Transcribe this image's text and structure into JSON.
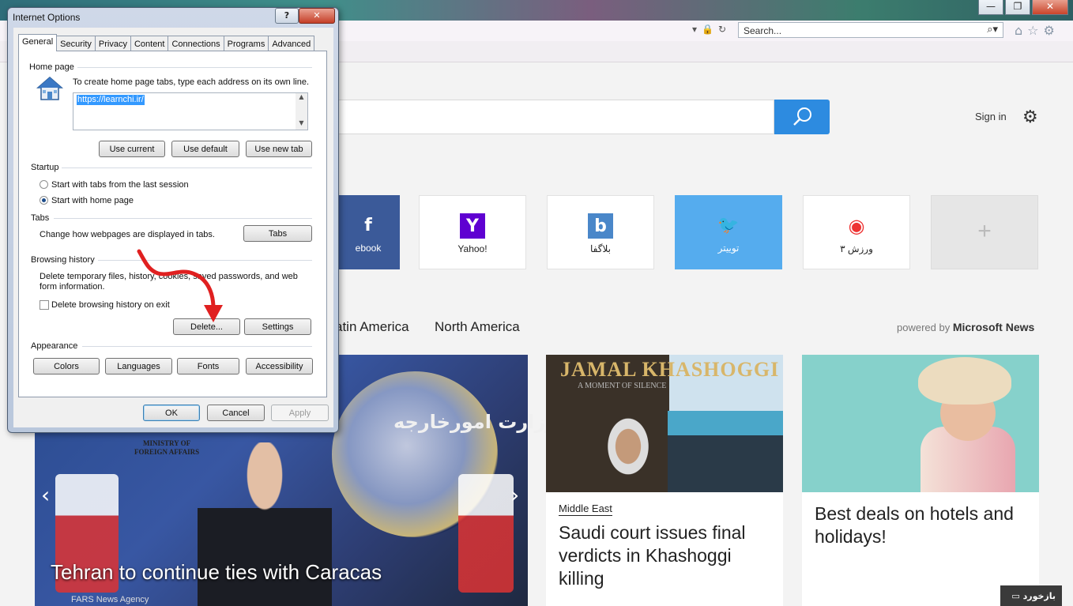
{
  "browser": {
    "window_buttons": {
      "minimize": "—",
      "maximize": "❐",
      "close": "✕"
    },
    "search_placeholder": "Search...",
    "nav_icons": {
      "home": "home-icon",
      "favorites": "star-icon",
      "tools": "gear-icon"
    }
  },
  "msn": {
    "sign_in": "Sign in",
    "tiles": [
      {
        "label": "ebook",
        "icon": "facebook-icon",
        "glyph": "f"
      },
      {
        "label": "Yahoo!",
        "icon": "yahoo-icon",
        "glyph": "Y"
      },
      {
        "label": "بلاگفا",
        "icon": "blogfa-icon",
        "glyph": "b"
      },
      {
        "label": "توییتر",
        "icon": "twitter-icon",
        "glyph": "🐦"
      },
      {
        "label": "ورزش ۳",
        "icon": "varzesh3-icon",
        "glyph": "◉"
      },
      {
        "label": "+",
        "icon": "add-icon",
        "glyph": "+"
      }
    ],
    "categories": [
      "atin America",
      "North America"
    ],
    "powered_by": "powered by",
    "powered_brand": "Microsoft News",
    "hero": {
      "title": "Tehran to continue ties with Caracas",
      "source": "FARS News Agency",
      "mfa_line1": "MINISTRY OF",
      "mfa_line2": "FOREIGN AFFAIRS",
      "arabic": "وزارت امورخارجه"
    },
    "card2": {
      "banner": "JAMAL KHASHOGGI",
      "banner_sub": "A MOMENT OF SILENCE",
      "tag": "Middle East",
      "title": "Saudi court issues final verdicts in Khashoggi killing"
    },
    "card3": {
      "title": "Best deals on hotels and holidays!"
    },
    "feedback": "بازخورد"
  },
  "dialog": {
    "title": "Internet Options",
    "help": "?",
    "close": "✕",
    "tabs": [
      "General",
      "Security",
      "Privacy",
      "Content",
      "Connections",
      "Programs",
      "Advanced"
    ],
    "active_tab": "General",
    "home_page": {
      "heading": "Home page",
      "instructions": "To create home page tabs, type each address on its own line.",
      "url": "https://learnchi.ir/",
      "use_current": "Use current",
      "use_default": "Use default",
      "use_new_tab": "Use new tab"
    },
    "startup": {
      "heading": "Startup",
      "option_last_session": "Start with tabs from the last session",
      "option_home_page": "Start with home page",
      "selected": "Start with home page"
    },
    "tabs_section": {
      "heading": "Tabs",
      "desc": "Change how webpages are displayed in tabs.",
      "button": "Tabs"
    },
    "browsing_history": {
      "heading": "Browsing history",
      "desc": "Delete temporary files, history, cookies, saved passwords, and web form information.",
      "delete_on_exit": "Delete browsing history on exit",
      "delete_on_exit_checked": false,
      "delete": "Delete...",
      "settings": "Settings"
    },
    "appearance": {
      "heading": "Appearance",
      "colors": "Colors",
      "languages": "Languages",
      "fonts": "Fonts",
      "accessibility": "Accessibility"
    },
    "ok": "OK",
    "cancel": "Cancel",
    "apply": "Apply"
  },
  "colors": {
    "accent": "#2d8be0",
    "annotation": "#e02020"
  }
}
